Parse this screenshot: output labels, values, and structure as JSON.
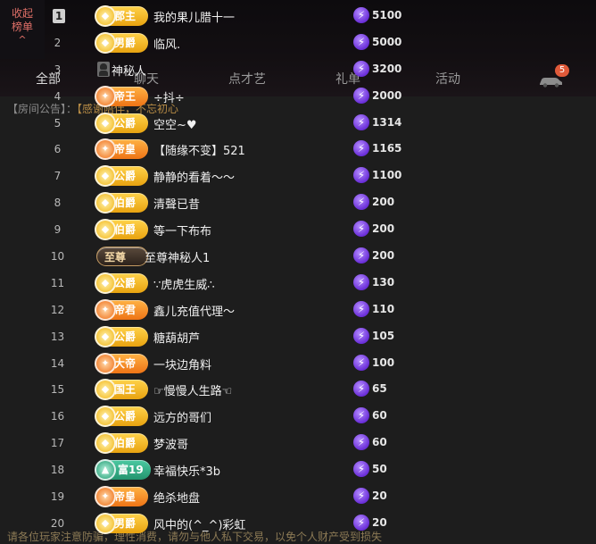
{
  "collapse": {
    "line1": "收起",
    "line2": "榜单",
    "chevron": "^"
  },
  "room_tabs": [
    {
      "label": "全部",
      "active": true
    },
    {
      "label": "聊天",
      "active": false
    },
    {
      "label": "点才艺",
      "active": false
    },
    {
      "label": "礼单",
      "active": false
    },
    {
      "label": "活动",
      "active": false
    }
  ],
  "car_badge": "5",
  "notice": {
    "prefix": "【房间公告】：",
    "highlight": "【感谢陪伴，不忘初心",
    "suffix": ""
  },
  "footer": "请各位玩家注意防骗，理性消费，请勿与他人私下交易，以免个人财产受到损失",
  "currency_icon": "lightning-bolt-icon",
  "ranking": [
    {
      "rank": "1",
      "badge": "郡主",
      "badge_style": "gold",
      "name": "我的果儿腊十一",
      "amount": "5100"
    },
    {
      "rank": "2",
      "badge": "男爵",
      "badge_style": "gold",
      "name": "临风.",
      "amount": "5000"
    },
    {
      "rank": "3",
      "badge": "",
      "badge_style": "none",
      "name": "神秘人",
      "amount": "3200"
    },
    {
      "rank": "4",
      "badge": "帝王",
      "badge_style": "orange",
      "name": "÷抖÷",
      "amount": "2000"
    },
    {
      "rank": "5",
      "badge": "公爵",
      "badge_style": "gold",
      "name": "空空~♥",
      "amount": "1314"
    },
    {
      "rank": "6",
      "badge": "帝皇",
      "badge_style": "orange",
      "name": "【随缘不变】521",
      "amount": "1165"
    },
    {
      "rank": "7",
      "badge": "公爵",
      "badge_style": "gold",
      "name": "静静的看着～～",
      "amount": "1100"
    },
    {
      "rank": "8",
      "badge": "伯爵",
      "badge_style": "gold",
      "name": "清聲已昔",
      "amount": "200"
    },
    {
      "rank": "9",
      "badge": "伯爵",
      "badge_style": "gold",
      "name": "等一下布布",
      "amount": "200"
    },
    {
      "rank": "10",
      "badge": "至尊",
      "badge_style": "dark",
      "name": "至尊神秘人1",
      "amount": "200"
    },
    {
      "rank": "11",
      "badge": "公爵",
      "badge_style": "gold",
      "name": "∵虎虎生威∴",
      "amount": "130"
    },
    {
      "rank": "12",
      "badge": "帝君",
      "badge_style": "orange",
      "name": "鑫儿充值代理～",
      "amount": "110"
    },
    {
      "rank": "13",
      "badge": "公爵",
      "badge_style": "gold",
      "name": "糖葫胡芦",
      "amount": "105"
    },
    {
      "rank": "14",
      "badge": "大帝",
      "badge_style": "orange",
      "name": "一块边角料",
      "amount": "100"
    },
    {
      "rank": "15",
      "badge": "国王",
      "badge_style": "gold",
      "name": "☞慢慢人生路☜",
      "amount": "65"
    },
    {
      "rank": "16",
      "badge": "公爵",
      "badge_style": "gold",
      "name": "远方的哥们",
      "amount": "60"
    },
    {
      "rank": "17",
      "badge": "伯爵",
      "badge_style": "gold",
      "name": "梦波哥",
      "amount": "60"
    },
    {
      "rank": "18",
      "badge": "富19",
      "badge_style": "teal",
      "name": "幸福快乐*3b",
      "amount": "50"
    },
    {
      "rank": "19",
      "badge": "帝皇",
      "badge_style": "orange",
      "name": "绝杀地盘",
      "amount": "20"
    },
    {
      "rank": "20",
      "badge": "男爵",
      "badge_style": "gold",
      "name": "风中的(^_^)彩虹",
      "amount": "20"
    }
  ]
}
